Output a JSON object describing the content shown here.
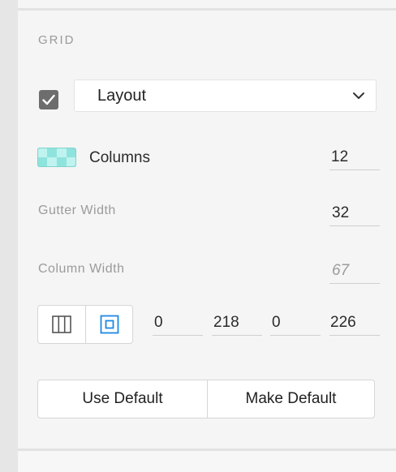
{
  "section": {
    "title": "GRID"
  },
  "layout_toggle": {
    "checked": true,
    "selected": "Layout"
  },
  "columns": {
    "label": "Columns",
    "value": "12"
  },
  "gutter": {
    "label": "Gutter Width",
    "value": "32"
  },
  "column_width": {
    "label": "Column Width",
    "value": "67"
  },
  "offsets": {
    "values": [
      "0",
      "218",
      "0",
      "226"
    ]
  },
  "actions": {
    "use_default": "Use Default",
    "make_default": "Make Default"
  },
  "colors": {
    "accent": "#1e88e5",
    "checkbox": "#6d6d6d",
    "swatch": "#a8ece7"
  },
  "icons": {
    "checkbox": "check-icon",
    "dropdown": "chevron-down-icon",
    "columns_mode": "columns-icon",
    "center_mode": "center-box-icon"
  }
}
